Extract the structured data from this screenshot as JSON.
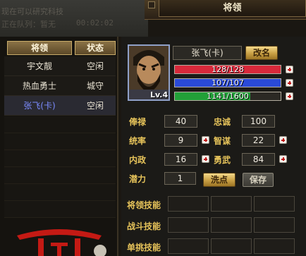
{
  "background": {
    "line1": "现在可以研究科技",
    "line2": "正在队列：暂无",
    "line3": "00:02:02"
  },
  "window": {
    "title": "将领"
  },
  "generals_list": {
    "headers": {
      "name": "将领",
      "status": "状态"
    },
    "rows": [
      {
        "name": "宇文靓",
        "status": "空闲"
      },
      {
        "name": "热血勇士",
        "status": "城守"
      },
      {
        "name": "张飞(卡)",
        "status": "空闲"
      }
    ]
  },
  "general": {
    "name": "张飞(卡)",
    "level": "Lv.4",
    "rename_label": "改名",
    "hp": {
      "text": "128/128",
      "fraction": 1.0,
      "color": "#d8283a"
    },
    "troops": {
      "text": "107/107",
      "fraction": 1.0,
      "color": "#2a4ad8"
    },
    "exp": {
      "text": "1141/1600",
      "fraction": 0.713,
      "color": "#22a038"
    }
  },
  "stats": {
    "salary": {
      "label": "俸禄",
      "value": "40"
    },
    "loyalty": {
      "label": "忠诚",
      "value": "100"
    },
    "command": {
      "label": "统率",
      "value": "9"
    },
    "intellect": {
      "label": "智谋",
      "value": "22"
    },
    "politics": {
      "label": "内政",
      "value": "16"
    },
    "valor": {
      "label": "勇武",
      "value": "84"
    },
    "potential": {
      "label": "潜力",
      "value": "1"
    }
  },
  "buttons": {
    "reset": "洗点",
    "save": "保存"
  },
  "skills": {
    "leader": "将领技能",
    "battle": "战斗技能",
    "duel": "单挑技能"
  },
  "colors": {
    "gold_label": "#e6c35a",
    "selected_name": "#7c8cff"
  }
}
